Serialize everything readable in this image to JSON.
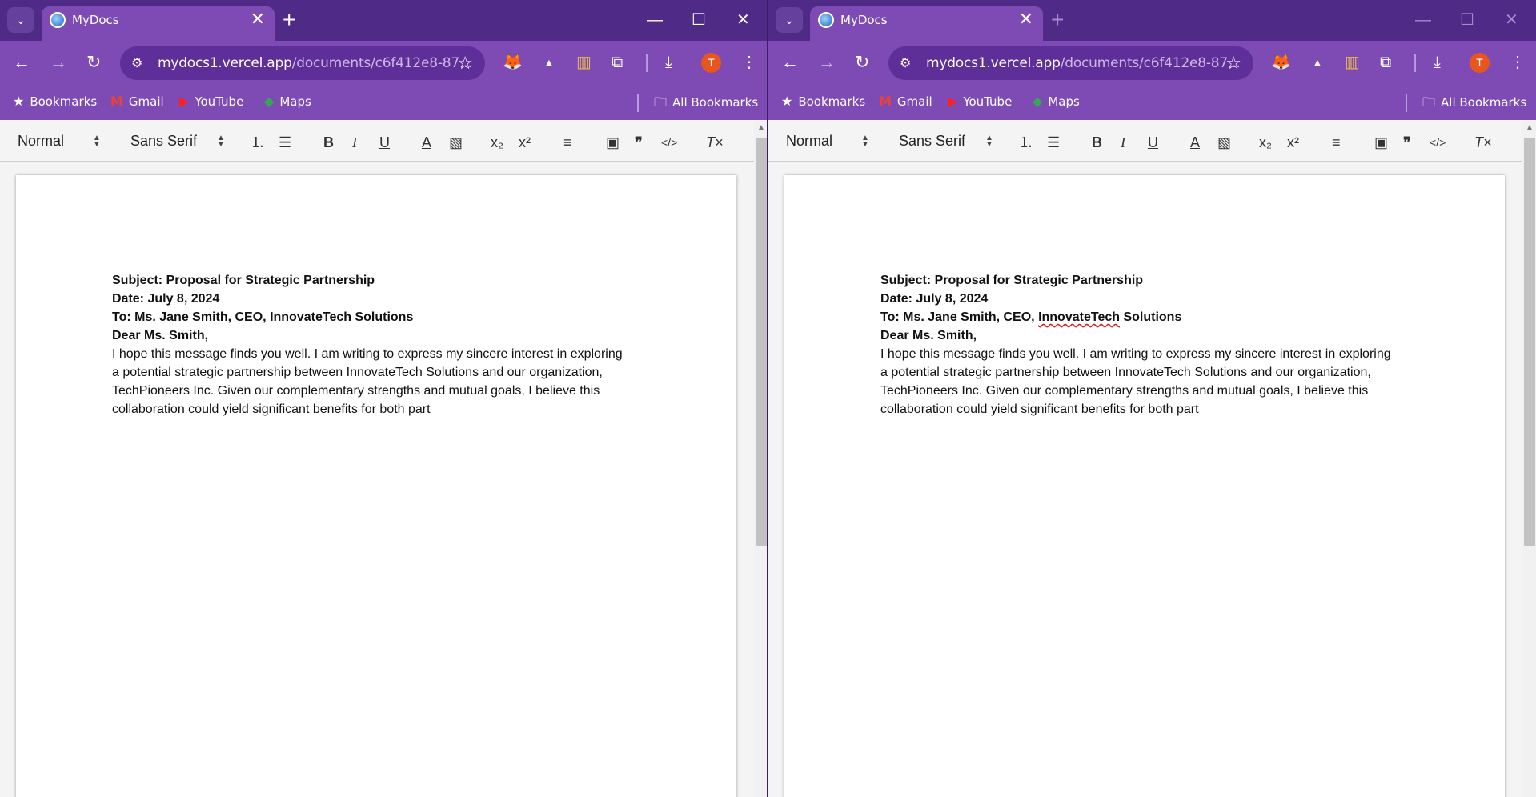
{
  "windows": [
    {
      "tab": {
        "title": "MyDocs",
        "close": "✕",
        "new_tab": "+"
      },
      "controls": {
        "minimize": "—",
        "maximize": "☐",
        "close": "✕"
      },
      "address": {
        "host": "mydocs1.vercel.app",
        "path": "/documents/c6f412e8-87..."
      },
      "bookmarks": [
        {
          "icon": "star-icon",
          "label": "Bookmarks"
        },
        {
          "icon": "gmail-icon",
          "label": "Gmail"
        },
        {
          "icon": "youtube-icon",
          "label": "YouTube"
        },
        {
          "icon": "maps-icon",
          "label": "Maps"
        }
      ],
      "all_bookmarks": "All Bookmarks",
      "avatar": "T",
      "editor": {
        "style_select": "Normal",
        "font_select": "Sans Serif"
      },
      "document": {
        "subject": "Subject: Proposal for Strategic Partnership",
        "date": "Date: July 8, 2024",
        "to": "To: Ms. Jane Smith, CEO, InnovateTech Solutions",
        "greeting": "Dear Ms. Smith,",
        "paragraph": "I hope this message finds you well. I am writing to express my sincere interest in exploring a potential strategic partnership between InnovateTech Solutions and our organization, TechPioneers Inc. Given our complementary strengths and mutual goals, I believe this collaboration could yield significant benefits for both part"
      }
    },
    {
      "tab": {
        "title": "MyDocs",
        "close": "✕",
        "new_tab": "+"
      },
      "controls": {
        "minimize": "—",
        "maximize": "☐",
        "close": "✕"
      },
      "address": {
        "host": "mydocs1.vercel.app",
        "path": "/documents/c6f412e8-87..."
      },
      "bookmarks": [
        {
          "icon": "star-icon",
          "label": "Bookmarks"
        },
        {
          "icon": "gmail-icon",
          "label": "Gmail"
        },
        {
          "icon": "youtube-icon",
          "label": "YouTube"
        },
        {
          "icon": "maps-icon",
          "label": "Maps"
        }
      ],
      "all_bookmarks": "All Bookmarks",
      "avatar": "T",
      "editor": {
        "style_select": "Normal",
        "font_select": "Sans Serif"
      },
      "document": {
        "subject": "Subject: Proposal for Strategic Partnership",
        "date": "Date: July 8, 2024",
        "to_prefix": "To: Ms. Jane Smith, CEO, ",
        "to_misspelled": "InnovateTech",
        "to_suffix": " Solutions",
        "greeting": "Dear Ms. Smith,",
        "paragraph": "I hope this message finds you well. I am writing to express my sincere interest in exploring a potential strategic partnership between InnovateTech Solutions and our organization, TechPioneers Inc. Given our complementary strengths and mutual goals, I believe this collaboration could yield significant benefits for both part"
      }
    }
  ],
  "colors": {
    "chrome_dark": "#4f2a86",
    "chrome": "#7e4bb5",
    "omnibox": "#5e2f98",
    "avatar": "#e8551f"
  }
}
